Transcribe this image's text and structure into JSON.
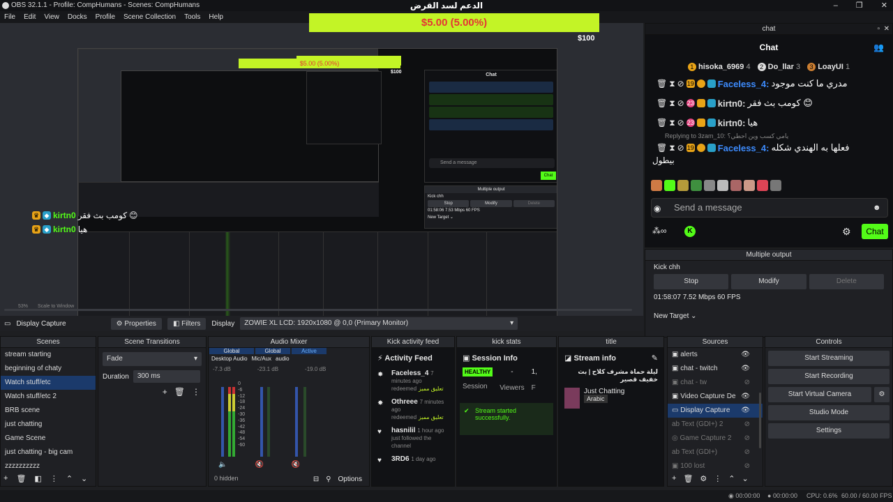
{
  "window": {
    "title": "OBS 32.1.1 - Profile: CompHumans - Scenes: CompHumans",
    "minimize": "–",
    "maximize": "❐",
    "close": "✕"
  },
  "menu": [
    "File",
    "Edit",
    "View",
    "Docks",
    "Profile",
    "Scene Collection",
    "Tools",
    "Help"
  ],
  "overlay": {
    "title": "الدعم لسد القرض",
    "donation_text": "$5.00 (5.00%)",
    "goal": "$100"
  },
  "mini": {
    "donation_text": "$5.00 (5.00%)",
    "goal": "$100",
    "chat_title": "Chat",
    "send_placeholder": "Send a message",
    "chat_btn": "Chat",
    "multi_title": "Multiple output",
    "kick": "Kick chh",
    "stop": "Stop",
    "modify": "Modify",
    "delete": "Delete",
    "stats": "01:58:06  7.53 Mbps  60 FPS",
    "new_target": "New Target ⌄"
  },
  "preview_overlay_chat": [
    {
      "user": "kirtn0",
      "msg": "كومب بث فقر"
    },
    {
      "user": "kirtn0",
      "msg": "هيا"
    }
  ],
  "preview_controls": {
    "zoom": "53%",
    "scale": "Scale to Window"
  },
  "chat": {
    "dock_title": "chat",
    "header": "Chat",
    "leaders": [
      {
        "name": "hisoka_6969",
        "count": "4"
      },
      {
        "name": "Do_llar",
        "count": "3"
      },
      {
        "name": "LoayUI",
        "count": "1"
      }
    ],
    "messages": [
      {
        "badge": "19",
        "user": "Faceless_4:",
        "msg": "مدري ما كنت موجود",
        "user_color": "#3d8bfd"
      },
      {
        "badge": "23",
        "user": "kirtn0:",
        "msg": "كومب بث فقر 😊",
        "user_color": "#dddddd"
      },
      {
        "badge": "23",
        "user": "kirtn0:",
        "msg": "هيا",
        "user_color": "#dddddd"
      },
      {
        "badge": "19",
        "user": "Faceless_4:",
        "msg": "فعلها به الهندي شكله",
        "user_color": "#3d8bfd"
      }
    ],
    "reply_note": "Replying to 3zam_10: يامي كسب وين احطي؟",
    "continuation": "بيطول",
    "send_placeholder": "Send a message",
    "chat_button": "Chat"
  },
  "multi_output": {
    "title": "Multiple output",
    "target": "Kick chh",
    "stop": "Stop",
    "modify": "Modify",
    "delete": "Delete",
    "stats": "01:58:07  7.52 Mbps  60 FPS",
    "new_target": "New Target ⌄"
  },
  "source_toolbar": {
    "source": "Display Capture",
    "properties": "Properties",
    "filters": "Filters",
    "display_label": "Display",
    "display_value": "ZOWIE XL LCD: 1920x1080 @ 0,0 (Primary Monitor)"
  },
  "scenes": {
    "title": "Scenes",
    "items": [
      "stream starting",
      "beginning of chaty",
      "Watch stuff/etc",
      "Watch stuff/etc 2",
      "BRB scene",
      "just chatting",
      "Game Scene",
      "just chatting - big cam",
      "zzzzzzzzzz"
    ],
    "selected_index": 2
  },
  "transitions": {
    "title": "Scene Transitions",
    "type": "Fade",
    "duration_label": "Duration",
    "duration": "300 ms"
  },
  "mixer": {
    "title": "Audio Mixer",
    "channels": [
      {
        "tag": "Global",
        "name": "Desktop Audio",
        "db": "-7.3 dB"
      },
      {
        "tag": "Global",
        "name": "Mic/Aux",
        "db": "-23.1 dB"
      },
      {
        "tag": "Active",
        "name": "audio",
        "db": "-19.0 dB"
      }
    ],
    "scale": [
      "0",
      "-6",
      "-12",
      "-18",
      "-24",
      "-30",
      "-36",
      "-42",
      "-48",
      "-54",
      "-60"
    ],
    "hidden": "0 hidden",
    "options": "Options"
  },
  "activity": {
    "dock_title": "Kick activity feed",
    "header": "Activity Feed",
    "items": [
      {
        "name": "Faceless_4",
        "time": "7 minutes ago",
        "detail": "redeemed",
        "reward": "تعليق مميز"
      },
      {
        "name": "Othreee",
        "time": "7 minutes ago",
        "detail": "redeemed",
        "reward": "تعليق مميز"
      },
      {
        "name": "hasnilil",
        "time": "1 hour ago",
        "detail": "just followed the channel",
        "reward": ""
      },
      {
        "name": "3RD6",
        "time": "1 day ago",
        "detail": "",
        "reward": ""
      }
    ]
  },
  "kick_stats": {
    "dock_title": "kick stats",
    "header": "Session Info",
    "status": "HEALTHY",
    "session": "Session",
    "viewers_value": "-",
    "viewers": "Viewers",
    "extra_value": "1,",
    "extra_label": "F",
    "toast": "Stream started successfully."
  },
  "title_dock": {
    "dock_title": "title",
    "header": "Stream info",
    "stream_title": "ليلة حماة مشرف كلاح | بث خفيف قصير",
    "category": "Just Chatting",
    "language": "Arabic"
  },
  "sources": {
    "title": "Sources",
    "items": [
      {
        "name": "alerts",
        "visible": true
      },
      {
        "name": "chat - twitch",
        "visible": true
      },
      {
        "name": "chat - tw",
        "visible": false
      },
      {
        "name": "Video Capture De",
        "visible": true
      },
      {
        "name": "Display Capture",
        "visible": true
      },
      {
        "name": "Text (GDI+) 2",
        "visible": false
      },
      {
        "name": "Game Capture 2",
        "visible": false
      },
      {
        "name": "Text (GDI+)",
        "visible": false
      },
      {
        "name": "100 lost",
        "visible": false
      }
    ],
    "selected_index": 4
  },
  "controls": {
    "title": "Controls",
    "start_streaming": "Start Streaming",
    "start_recording": "Start Recording",
    "start_virtual_camera": "Start Virtual Camera",
    "studio_mode": "Studio Mode",
    "settings": "Settings"
  },
  "status": {
    "timer1": "00:00:00",
    "timer2": "00:00:00",
    "cpu": "CPU: 0.6%",
    "fps": "60.00 / 60.00 FPS"
  },
  "colors": {
    "accent": "#c3f426",
    "kick_green": "#53fc18",
    "selection": "#1b3a6b",
    "donation_text": "#e53535"
  }
}
